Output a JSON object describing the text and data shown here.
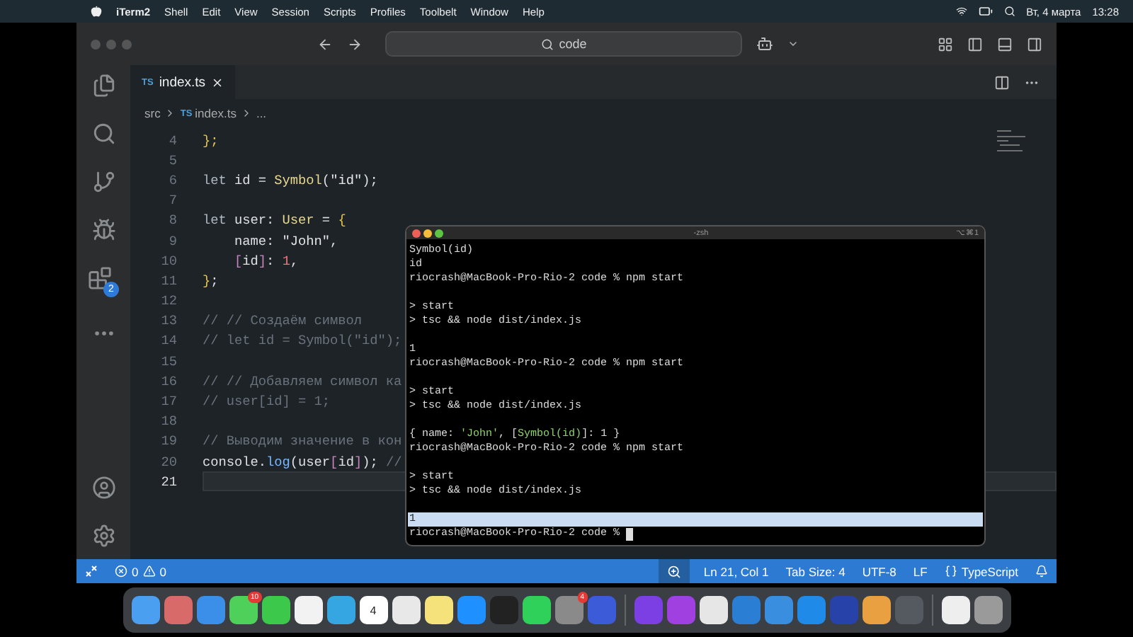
{
  "menu_bar": {
    "app": "iTerm2",
    "items": [
      "Shell",
      "Edit",
      "View",
      "Session",
      "Scripts",
      "Profiles",
      "Toolbelt",
      "Window",
      "Help"
    ],
    "date": "Вт, 4 марта",
    "time": "13:28"
  },
  "title_bar": {
    "search": "code"
  },
  "activity_bar": {
    "extensions_badge": "2"
  },
  "tabs": [
    {
      "badge": "TS",
      "label": "index.ts",
      "selected": true
    }
  ],
  "breadcrumbs": [
    {
      "label": "src"
    },
    {
      "badge": "TS",
      "label": "index.ts"
    },
    {
      "label": "..."
    }
  ],
  "editor": {
    "lines": [
      {
        "number": "4",
        "selected": false,
        "tokens": [
          {
            "kind": "brace",
            "text": "};"
          }
        ]
      },
      {
        "number": "5",
        "selected": false
      },
      {
        "number": "6",
        "selected": false,
        "tokens": [
          {
            "kind": "kw",
            "text": "let"
          },
          {
            "kind": "plain",
            "text": " id = "
          },
          {
            "kind": "fn",
            "text": "Symbol"
          },
          {
            "kind": "plain",
            "text": "("
          },
          {
            "kind": "str",
            "text": "\"id\""
          },
          {
            "kind": "plain",
            "text": ");"
          }
        ]
      },
      {
        "number": "7",
        "selected": false
      },
      {
        "number": "8",
        "selected": false,
        "tokens": [
          {
            "kind": "kw",
            "text": "let"
          },
          {
            "kind": "plain",
            "text": " user: "
          },
          {
            "kind": "type",
            "text": "User"
          },
          {
            "kind": "plain",
            "text": " = "
          },
          {
            "kind": "brace",
            "text": "{"
          }
        ]
      },
      {
        "number": "9",
        "selected": false,
        "indented": true,
        "tokens": [
          {
            "kind": "plain",
            "text": "name: "
          },
          {
            "kind": "str",
            "text": "\"John\""
          },
          {
            "kind": "plain",
            "text": ","
          }
        ]
      },
      {
        "number": "10",
        "selected": false,
        "indented": true,
        "tokens": [
          {
            "kind": "bracket",
            "text": "["
          },
          {
            "kind": "plain",
            "text": "id"
          },
          {
            "kind": "bracket",
            "text": "]"
          },
          {
            "kind": "plain",
            "text": ": "
          },
          {
            "kind": "num",
            "text": "1"
          },
          {
            "kind": "plain",
            "text": ","
          }
        ]
      },
      {
        "number": "11",
        "selected": false,
        "tokens": [
          {
            "kind": "brace",
            "text": "}"
          },
          {
            "kind": "plain",
            "text": ";"
          }
        ]
      },
      {
        "number": "12",
        "selected": false
      },
      {
        "number": "13",
        "selected": false,
        "tokens": [
          {
            "kind": "comment",
            "text": "// // Создаём символ"
          }
        ]
      },
      {
        "number": "14",
        "selected": false,
        "tokens": [
          {
            "kind": "comment",
            "text": "// let id = Symbol(\"id\");"
          }
        ]
      },
      {
        "number": "15",
        "selected": false
      },
      {
        "number": "16",
        "selected": false,
        "tokens": [
          {
            "kind": "comment",
            "text": "// // Добавляем символ ка"
          }
        ]
      },
      {
        "number": "17",
        "selected": false,
        "tokens": [
          {
            "kind": "comment",
            "text": "// user[id] = 1;"
          }
        ]
      },
      {
        "number": "18",
        "selected": false
      },
      {
        "number": "19",
        "selected": false,
        "tokens": [
          {
            "kind": "comment",
            "text": "// Выводим значение в кон"
          }
        ]
      },
      {
        "number": "20",
        "selected": false,
        "tokens": [
          {
            "kind": "plain",
            "text": "console."
          },
          {
            "kind": "fn2",
            "text": "log"
          },
          {
            "kind": "plain",
            "text": "(user"
          },
          {
            "kind": "bracket",
            "text": "["
          },
          {
            "kind": "plain",
            "text": "id"
          },
          {
            "kind": "bracket",
            "text": "]"
          },
          {
            "kind": "plain",
            "text": "); "
          },
          {
            "kind": "comment",
            "text": "//"
          }
        ]
      },
      {
        "number": "21",
        "selected": true
      }
    ]
  },
  "terminal": {
    "title": "-zsh",
    "shortcut": "⌥⌘1",
    "lines": [
      {
        "kind": "output",
        "text": "Symbol(id)"
      },
      {
        "kind": "output",
        "text": "id"
      },
      {
        "kind": "output",
        "text": "riocrash@MacBook-Pro-Rio-2 code % npm start"
      },
      {
        "kind": "blank"
      },
      {
        "kind": "output",
        "text": "> start"
      },
      {
        "kind": "output",
        "text": "> tsc && node dist/index.js"
      },
      {
        "kind": "blank"
      },
      {
        "kind": "output",
        "text": "1"
      },
      {
        "kind": "output",
        "text": "riocrash@MacBook-Pro-Rio-2 code % npm start"
      },
      {
        "kind": "blank"
      },
      {
        "kind": "output",
        "text": "> start"
      },
      {
        "kind": "output",
        "text": "> tsc && node dist/index.js"
      },
      {
        "kind": "blank"
      },
      {
        "kind": "object",
        "parts": [
          {
            "text": "{ name: ",
            "green": false
          },
          {
            "text": "'John'",
            "green": true
          },
          {
            "text": ", [",
            "green": false
          },
          {
            "text": "Symbol(id)",
            "green": true
          },
          {
            "text": "]: 1 }",
            "green": false
          }
        ]
      },
      {
        "kind": "output",
        "text": "riocrash@MacBook-Pro-Rio-2 code % npm start"
      },
      {
        "kind": "blank"
      },
      {
        "kind": "output",
        "text": "> start"
      },
      {
        "kind": "output",
        "text": "> tsc && node dist/index.js"
      },
      {
        "kind": "blank"
      },
      {
        "kind": "highlight",
        "text": "1"
      },
      {
        "kind": "prompt",
        "text": "riocrash@MacBook-Pro-Rio-2 code %"
      }
    ]
  },
  "status_bar": {
    "errors": "0",
    "warnings": "0",
    "items": [
      "Ln 21, Col 1",
      "Tab Size: 4",
      "UTF-8",
      "LF"
    ],
    "language": "TypeScript"
  },
  "dock": {
    "apps": [
      {
        "color": "#4a9ff0"
      },
      {
        "color": "#d86a6a"
      },
      {
        "color": "#3b8fe8"
      },
      {
        "color": "#4fd05a",
        "badge": "10"
      },
      {
        "color": "#3cc84a"
      },
      {
        "color": "#f2f2f2"
      },
      {
        "color": "#35a6e2"
      },
      {
        "color": "#ffffff",
        "label": "4"
      },
      {
        "color": "#e8e8e8"
      },
      {
        "color": "#f5e27a"
      },
      {
        "color": "#1e90ff"
      },
      {
        "color": "#222222"
      },
      {
        "color": "#2fd15a"
      },
      {
        "color": "#8a8a8a",
        "badge": "4"
      },
      {
        "color": "#3b5bd8"
      }
    ],
    "recent": [
      {
        "color": "#7b3fe4"
      },
      {
        "color": "#a040e0"
      },
      {
        "color": "#e6e6e6"
      },
      {
        "color": "#2a7fd4"
      },
      {
        "color": "#3a8ee0"
      },
      {
        "color": "#1f8ae8"
      },
      {
        "color": "#2742a8"
      },
      {
        "color": "#e8a040"
      },
      {
        "color": "#555a60"
      }
    ],
    "system": [
      {
        "color": "#eeeeee"
      },
      {
        "color": "#9a9a9a"
      }
    ]
  }
}
